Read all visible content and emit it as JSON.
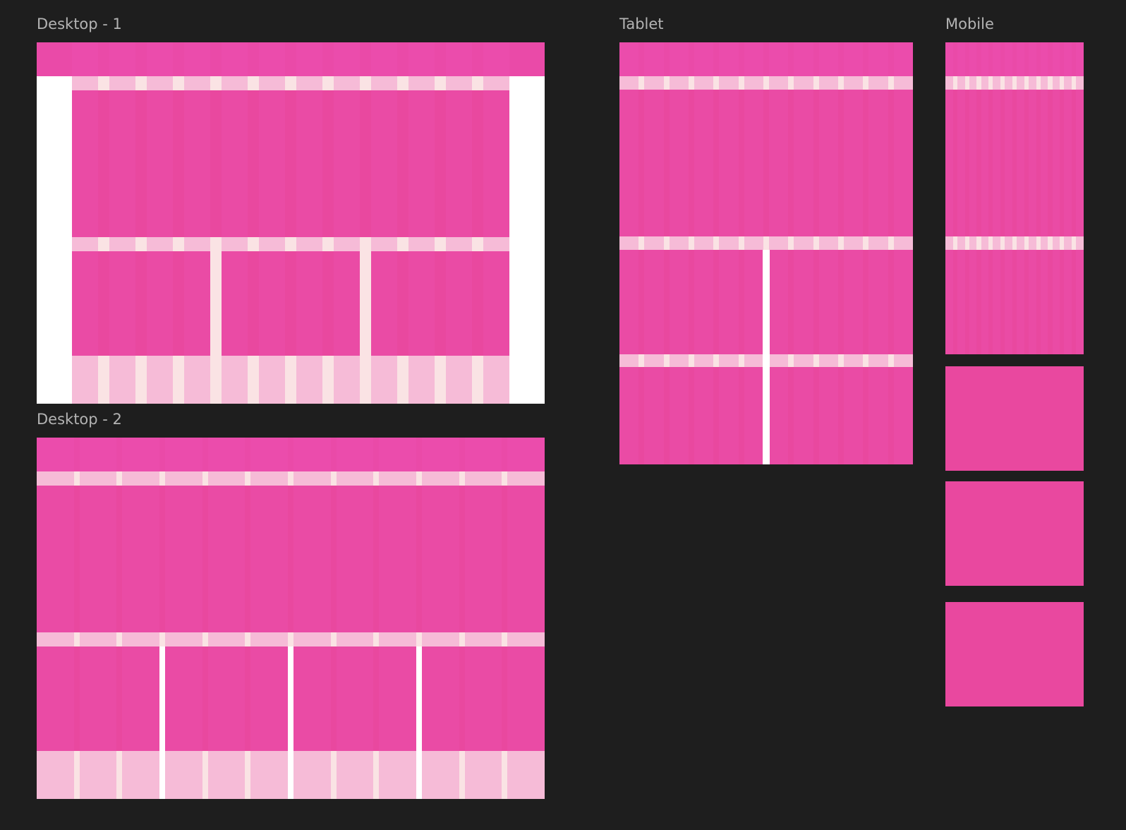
{
  "canvas": {
    "background": "#1e1e1e"
  },
  "colors": {
    "block": "#e9489f",
    "header": "#ea4aa8",
    "band": "#fae3e4",
    "frame": "#ffffff",
    "label": "#b3b3b3"
  },
  "frames": {
    "desktop1": {
      "label": "Desktop - 1",
      "columns": 12
    },
    "desktop2": {
      "label": "Desktop - 2",
      "columns": 12
    },
    "tablet": {
      "label": "Tablet",
      "columns": 12
    },
    "mobile": {
      "label": "Mobile",
      "columns": 12
    }
  }
}
